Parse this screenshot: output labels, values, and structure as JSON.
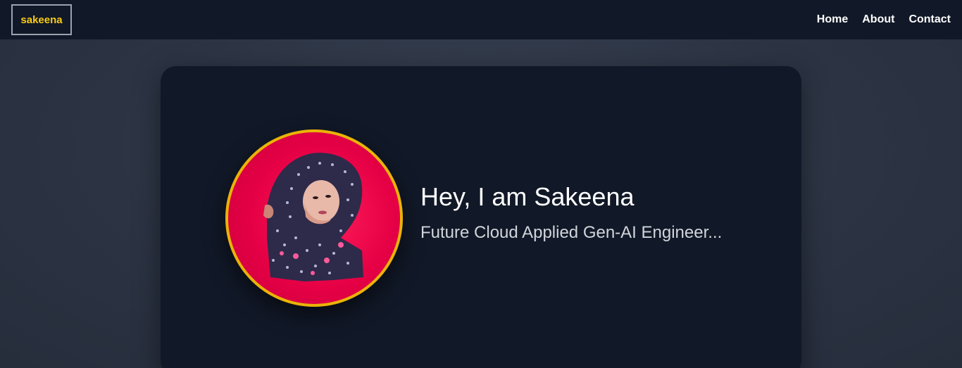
{
  "nav": {
    "logo": "sakeena",
    "links": [
      "Home",
      "About",
      "Contact"
    ]
  },
  "hero": {
    "greeting": "Hey, I am Sakeena",
    "tagline": "Future Cloud Applied Gen-AI Engineer..."
  },
  "colors": {
    "nav_bg": "#111827",
    "accent": "#facc15",
    "avatar_bg": "#e60045",
    "ring": "#eab308"
  }
}
